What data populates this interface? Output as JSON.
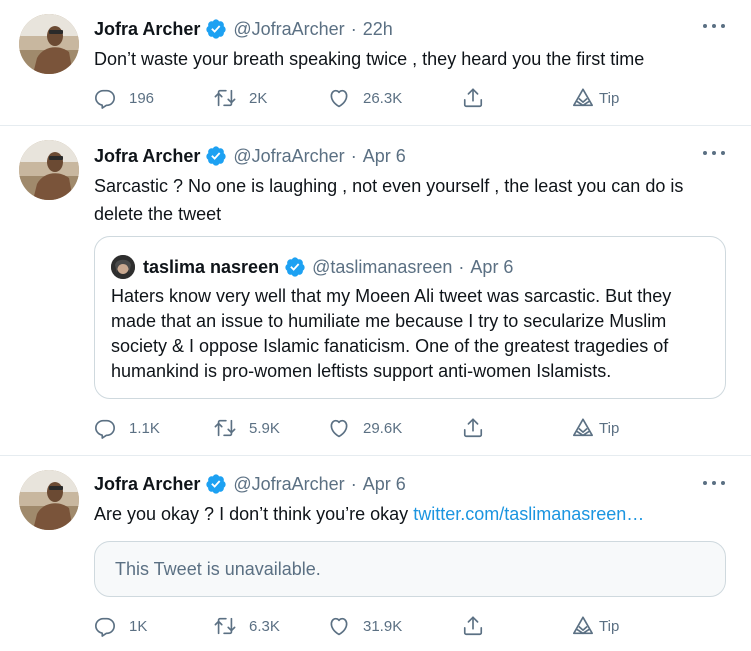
{
  "tweets": [
    {
      "name": "Jofra Archer",
      "handle": "@JofraArcher",
      "separator": "·",
      "time": "22h",
      "text": "Don’t waste your breath speaking twice , they heard you the first time",
      "replies": "196",
      "retweets": "2K",
      "likes": "26.3K",
      "tip": "Tip"
    },
    {
      "name": "Jofra Archer",
      "handle": "@JofraArcher",
      "separator": "·",
      "time": "Apr 6",
      "text": "Sarcastic ? No one is laughing , not even yourself , the least you can do is delete the tweet",
      "quote": {
        "name": "taslima nasreen",
        "handle": "@taslimanasreen",
        "separator": "·",
        "time": "Apr 6",
        "text": "Haters know very well that my Moeen Ali tweet was sarcastic. But they made that an issue to humiliate me because I try to secularize Muslim society & I oppose Islamic fanaticism. One of the greatest tragedies of humankind is pro-women leftists support anti-women Islamists."
      },
      "replies": "1.1K",
      "retweets": "5.9K",
      "likes": "29.6K",
      "tip": "Tip"
    },
    {
      "name": "Jofra Archer",
      "handle": "@JofraArcher",
      "separator": "·",
      "time": "Apr 6",
      "text": "Are you okay ? I don’t think you’re okay",
      "link": "twitter.com/taslimanasreen…",
      "unavailable": "This Tweet is unavailable.",
      "replies": "1K",
      "retweets": "6.3K",
      "likes": "31.9K",
      "tip": "Tip"
    }
  ],
  "colors": {
    "verified": "#1da1f2",
    "link": "#1b95e0",
    "secondary_text": "#5b7083",
    "border": "#e6ecf0"
  },
  "icons": [
    "avatar-photo",
    "verified-badge-icon",
    "more-icon",
    "reply-icon",
    "retweet-icon",
    "like-icon",
    "share-icon",
    "tip-icon"
  ]
}
